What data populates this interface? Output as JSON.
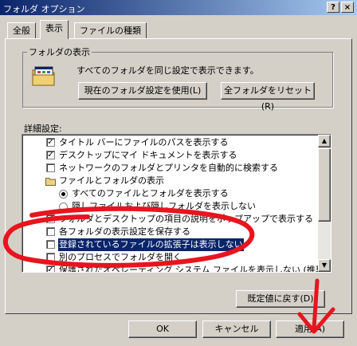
{
  "window": {
    "title": "フォルダ オプション",
    "help_label": "?",
    "close_label": "×"
  },
  "tabs": [
    "全般",
    "表示",
    "ファイルの種類"
  ],
  "folder_view": {
    "group_label": "フォルダの表示",
    "description": "すべてのフォルダを同じ設定で表示できます。",
    "apply_current_label": "現在のフォルダ設定を使用(L)",
    "reset_all_label": "全フォルダをリセット(R)"
  },
  "advanced": {
    "label": "詳細設定:",
    "items": [
      {
        "type": "checkbox",
        "checked": true,
        "text": "タイトル バーにファイルのパスを表示する"
      },
      {
        "type": "checkbox",
        "checked": true,
        "text": "デスクトップにマイ ドキュメントを表示する"
      },
      {
        "type": "checkbox",
        "checked": false,
        "text": "ネットワークのフォルダとプリンタを自動的に検索する"
      },
      {
        "type": "folder",
        "checked": false,
        "text": "ファイルとフォルダの表示"
      },
      {
        "type": "radio",
        "checked": true,
        "text": "すべてのファイルとフォルダを表示する"
      },
      {
        "type": "radio",
        "checked": false,
        "text": "隠しファイルおよび隠しフォルダを表示しない"
      },
      {
        "type": "checkbox",
        "checked": true,
        "text": "フォルダとデスクトップの項目の説明をポップアップで表示する"
      },
      {
        "type": "checkbox",
        "checked": false,
        "text": "各フォルダの表示設定を保存する"
      },
      {
        "type": "checkbox",
        "checked": false,
        "text": "登録されているファイルの拡張子は表示しない",
        "selected": true
      },
      {
        "type": "checkbox",
        "checked": false,
        "text": "別のプロセスでフォルダを開く"
      },
      {
        "type": "checkbox",
        "checked": true,
        "text": "保護されたオペレーティング システム ファイルを表示しない (推奨)"
      }
    ],
    "restore_defaults_label": "既定値に戻す(D)"
  },
  "footer": {
    "ok_label": "OK",
    "cancel_label": "キャンセル",
    "apply_label": "適用(A)"
  },
  "colors": {
    "highlight": "#0a246a",
    "annotation": "#e8141e"
  },
  "icons": {
    "folder_view": "folder-window-icon",
    "tree_folder": "folder-icon"
  }
}
